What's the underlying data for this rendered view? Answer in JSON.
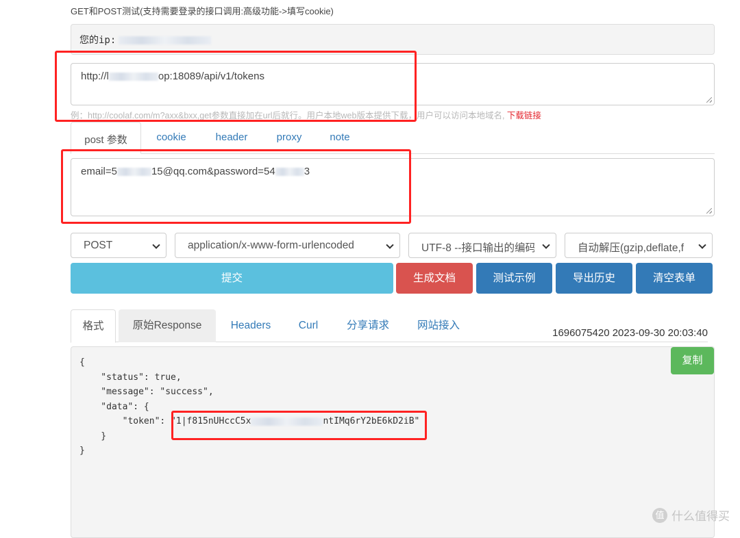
{
  "page": {
    "title": "GET和POST测试(支持需要登录的接口调用:高级功能->填写cookie)"
  },
  "ip": {
    "label": "您的ip:"
  },
  "url": {
    "prefix": "http://l",
    "suffix": "op:18089/api/v1/tokens"
  },
  "hint": {
    "text": "例：http://coolaf.com/m?axx&bxx,get参数直接加在url后就行。用户本地web版本提供下载，用户可以访问本地域名,",
    "link": "下载链接"
  },
  "request_tabs": [
    {
      "label": "post 参数",
      "active": true
    },
    {
      "label": "cookie"
    },
    {
      "label": "header"
    },
    {
      "label": "proxy"
    },
    {
      "label": "note"
    }
  ],
  "body": {
    "prefix": "email=5",
    "middle": "15@qq.com&password=54",
    "suffix": "3"
  },
  "selects": {
    "method": "POST",
    "content_type": "application/x-www-form-urlencoded",
    "encoding": "UTF-8 --接口输出的编码",
    "decompress": "自动解压(gzip,deflate,f"
  },
  "buttons": {
    "submit": "提交",
    "generate_doc": "生成文档",
    "test_example": "测试示例",
    "export_history": "导出历史",
    "clear_form": "清空表单",
    "copy": "复制"
  },
  "response_tabs": [
    {
      "label": "格式",
      "active": true
    },
    {
      "label": "原始Response"
    },
    {
      "label": "Headers"
    },
    {
      "label": "Curl"
    },
    {
      "label": "分享请求"
    },
    {
      "label": "网站接入"
    }
  ],
  "response": {
    "timestamp": "1696075420 2023-09-30 20:03:40",
    "lines": {
      "l1": "{",
      "l2": "    \"status\": true,",
      "l3": "    \"message\": \"success\",",
      "l4": "    \"data\": {",
      "l5_key": "        \"token\": ",
      "l5_prefix": "\"1|f815nUHccC5x",
      "l5_suffix": "ntIMq6rY2bE6kD2iB\"",
      "l6": "    }",
      "l7": "}"
    }
  },
  "watermark": {
    "icon": "值",
    "text": "什么值得买"
  }
}
